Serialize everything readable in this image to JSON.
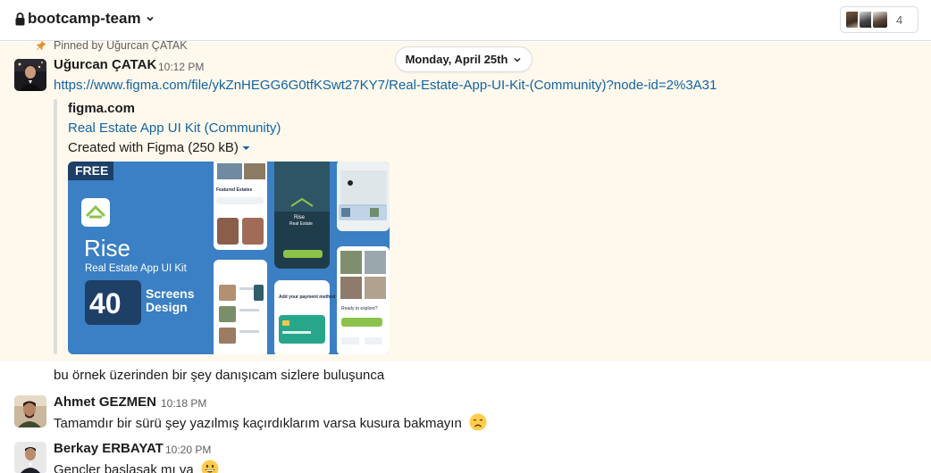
{
  "header": {
    "channel_name": "bootcamp-team",
    "member_count": "4"
  },
  "pinned": {
    "text": "Pinned by Uğurcan ÇATAK"
  },
  "date_divider": {
    "label": "Monday, April 25th"
  },
  "messages": [
    {
      "author": "Uğurcan ÇATAK",
      "time": "10:12 PM",
      "link": "https://www.figma.com/file/ykZnHEGG6G0tfKSwt27KY7/Real-Estate-App-UI-Kit-(Community)?node-id=2%3A31",
      "unfurl": {
        "site": "figma.com",
        "title": "Real Estate App UI Kit (Community)",
        "meta": "Created with Figma (250 kB)",
        "preview": {
          "badge": "FREE",
          "brand": "Rise",
          "subtitle": "Real Estate App UI Kit",
          "count": "40",
          "screens_line1": "Screens",
          "screens_line2": "Design",
          "phone_brand": "Rise",
          "phone_sub": "Real Estate",
          "featured": "Featured Estates",
          "add_payment": "Add your payment method",
          "ready": "Ready to explore?"
        }
      },
      "followup": "bu örnek üzerinden bir şey danışıcam sizlere buluşunca"
    },
    {
      "author": "Ahmet GEZMEN",
      "time": "10:18 PM",
      "text": "Tamamdır bir sürü şey yazılmış kaçırdıklarım varsa kusura bakmayın",
      "emoji": "disappointed-face"
    },
    {
      "author": "Berkay ERBAYAT",
      "time": "10:20 PM",
      "text": "Gencler baslasak mı va",
      "emoji": "grinning-face"
    }
  ],
  "colors": {
    "link": "#1264a3",
    "pinned_bg": "#fef9ec",
    "figma_blue": "#3b7fc4",
    "accent_green": "#8bc34a"
  }
}
